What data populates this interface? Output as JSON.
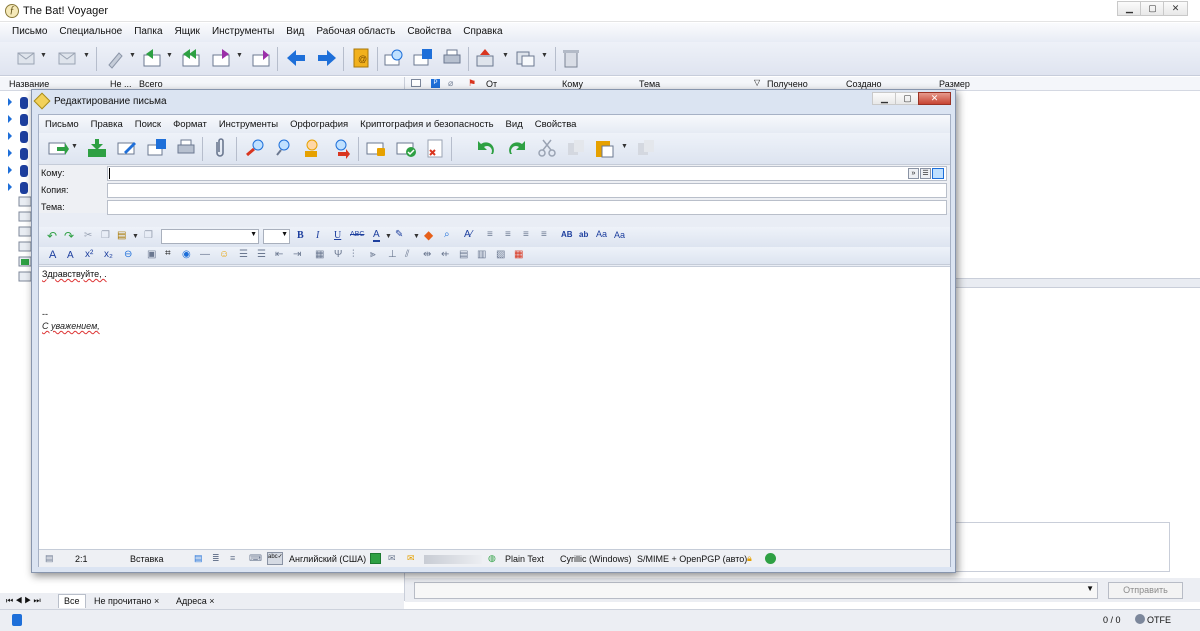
{
  "main": {
    "title": "The Bat! Voyager",
    "menu": [
      "Письмо",
      "Специальное",
      "Папка",
      "Ящик",
      "Инструменты",
      "Вид",
      "Рабочая область",
      "Свойства",
      "Справка"
    ],
    "folder_columns": {
      "name": "Название",
      "unread": "Не ...",
      "total": "Всего"
    },
    "message_columns": {
      "from": "От",
      "to": "Кому",
      "subject": "Тема",
      "received": "Получено",
      "created": "Создано",
      "size": "Размер"
    },
    "tabs": [
      "Все",
      "Не прочитано",
      "Адреса"
    ],
    "send_label": "Отправить",
    "counts": "0 / 0",
    "otfe": "OTFE"
  },
  "editor": {
    "title": "Редактирование письма",
    "menu": [
      "Письмо",
      "Правка",
      "Поиск",
      "Формат",
      "Инструменты",
      "Орфография",
      "Криптография и безопасность",
      "Вид",
      "Свойства"
    ],
    "fields": {
      "to": "Кому:",
      "cc": "Копия:",
      "subject": "Тема:"
    },
    "body": {
      "greeting": "Здравствуйте, .",
      "sig_separator": "--",
      "signature": "С уважением,"
    },
    "status": {
      "position": "2:1",
      "mode": "Вставка",
      "language": "Английский (США)",
      "format": "Plain Text",
      "charset": "Cyrillic (Windows)",
      "security": "S/MIME + OpenPGP (авто)"
    }
  },
  "colors": {
    "accent_blue": "#1e6fd9",
    "green": "#2ea043",
    "gold": "#e6a100",
    "red": "#d9351f",
    "purple": "#9b2fa8"
  }
}
